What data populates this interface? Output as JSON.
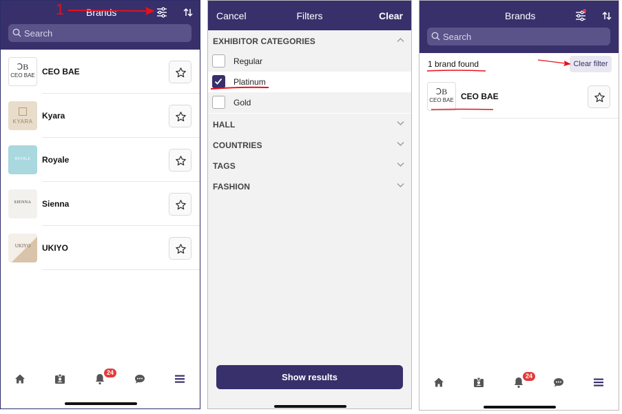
{
  "panel_list": {
    "title": "Brands",
    "search_placeholder": "Search",
    "brands": [
      {
        "name": "CEO BAE",
        "logo_text": "CEO BAE"
      },
      {
        "name": "Kyara",
        "logo_text": "KYARA"
      },
      {
        "name": "Royale",
        "logo_text": "ROYALE"
      },
      {
        "name": "Sienna",
        "logo_text": "SIENNA"
      },
      {
        "name": "UKIYO",
        "logo_text": "UKIYO"
      }
    ],
    "notification_count": "24"
  },
  "panel_filters": {
    "cancel_label": "Cancel",
    "title": "Filters",
    "clear_label": "Clear",
    "sections": [
      {
        "label": "EXHIBITOR CATEGORIES",
        "expanded": true
      },
      {
        "label": "HALL"
      },
      {
        "label": "COUNTRIES"
      },
      {
        "label": "TAGS"
      },
      {
        "label": "FASHION"
      }
    ],
    "options": [
      {
        "label": "Regular",
        "checked": false
      },
      {
        "label": "Platinum",
        "checked": true
      },
      {
        "label": "Gold",
        "checked": false
      }
    ],
    "show_results_label": "Show results"
  },
  "panel_results": {
    "title": "Brands",
    "search_placeholder": "Search",
    "found_text": "1 brand found",
    "clear_filter_label": "Clear filter",
    "brands": [
      {
        "name": "CEO BAE",
        "logo_text": "CEO BAE"
      }
    ],
    "notification_count": "24"
  },
  "annotation": {
    "step_number": "1",
    "color": "#e8101a"
  },
  "colors": {
    "header": "#37306b",
    "search_bg": "#5a5389",
    "badge": "#e23b3b"
  }
}
